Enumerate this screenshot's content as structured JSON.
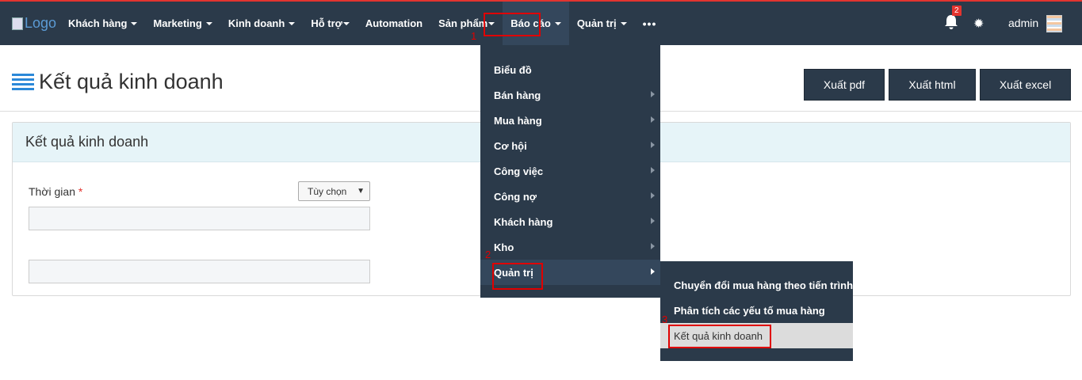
{
  "brand": {
    "logo_alt": "Logo"
  },
  "nav": {
    "items": [
      {
        "label": "Khách hàng",
        "has_caret": true
      },
      {
        "label": "Marketing",
        "has_caret": true
      },
      {
        "label": "Kinh doanh",
        "has_caret": true
      },
      {
        "label": "Hỗ trợ",
        "has_caret": true
      },
      {
        "label": "Automation",
        "has_caret": false
      },
      {
        "label": "Sản phẩm",
        "has_caret": true
      },
      {
        "label": "Báo cáo",
        "has_caret": true,
        "active": true
      },
      {
        "label": "Quản trị",
        "has_caret": true
      }
    ],
    "more_icon": "ellipsis-icon",
    "notifications_count": "2",
    "user_name": "admin"
  },
  "annotations": {
    "marker_1": "1",
    "marker_2": "2",
    "marker_3": "3",
    "color": "#e00000"
  },
  "page": {
    "title": "Kết quả kinh doanh",
    "buttons": {
      "export_pdf": "Xuất pdf",
      "export_html": "Xuất html",
      "export_excel": "Xuất excel"
    }
  },
  "panel": {
    "heading": "Kết quả kinh doanh",
    "time_label": "Thời gian",
    "required_mark": "*",
    "range_select": "Tùy chọn"
  },
  "menu": {
    "items": [
      {
        "label": "Biểu đồ",
        "has_submenu": false
      },
      {
        "label": "Bán hàng",
        "has_submenu": true
      },
      {
        "label": "Mua hàng",
        "has_submenu": true
      },
      {
        "label": "Cơ hội",
        "has_submenu": true
      },
      {
        "label": "Công việc",
        "has_submenu": true
      },
      {
        "label": "Công nợ",
        "has_submenu": true
      },
      {
        "label": "Khách hàng",
        "has_submenu": true
      },
      {
        "label": "Kho",
        "has_submenu": true
      },
      {
        "label": "Quản trị",
        "has_submenu": true,
        "highlighted": true
      }
    ]
  },
  "submenu": {
    "items": [
      {
        "label": "Chuyển đổi mua hàng theo tiến trình"
      },
      {
        "label": "Phân tích các yếu tố mua hàng"
      },
      {
        "label": "Kết quả kinh doanh",
        "selected": true
      }
    ]
  },
  "colors": {
    "navbar": "#2b3a4a",
    "accent_blue": "#2b88d8",
    "panel_header": "#e6f4f8",
    "required": "#e3342f"
  }
}
